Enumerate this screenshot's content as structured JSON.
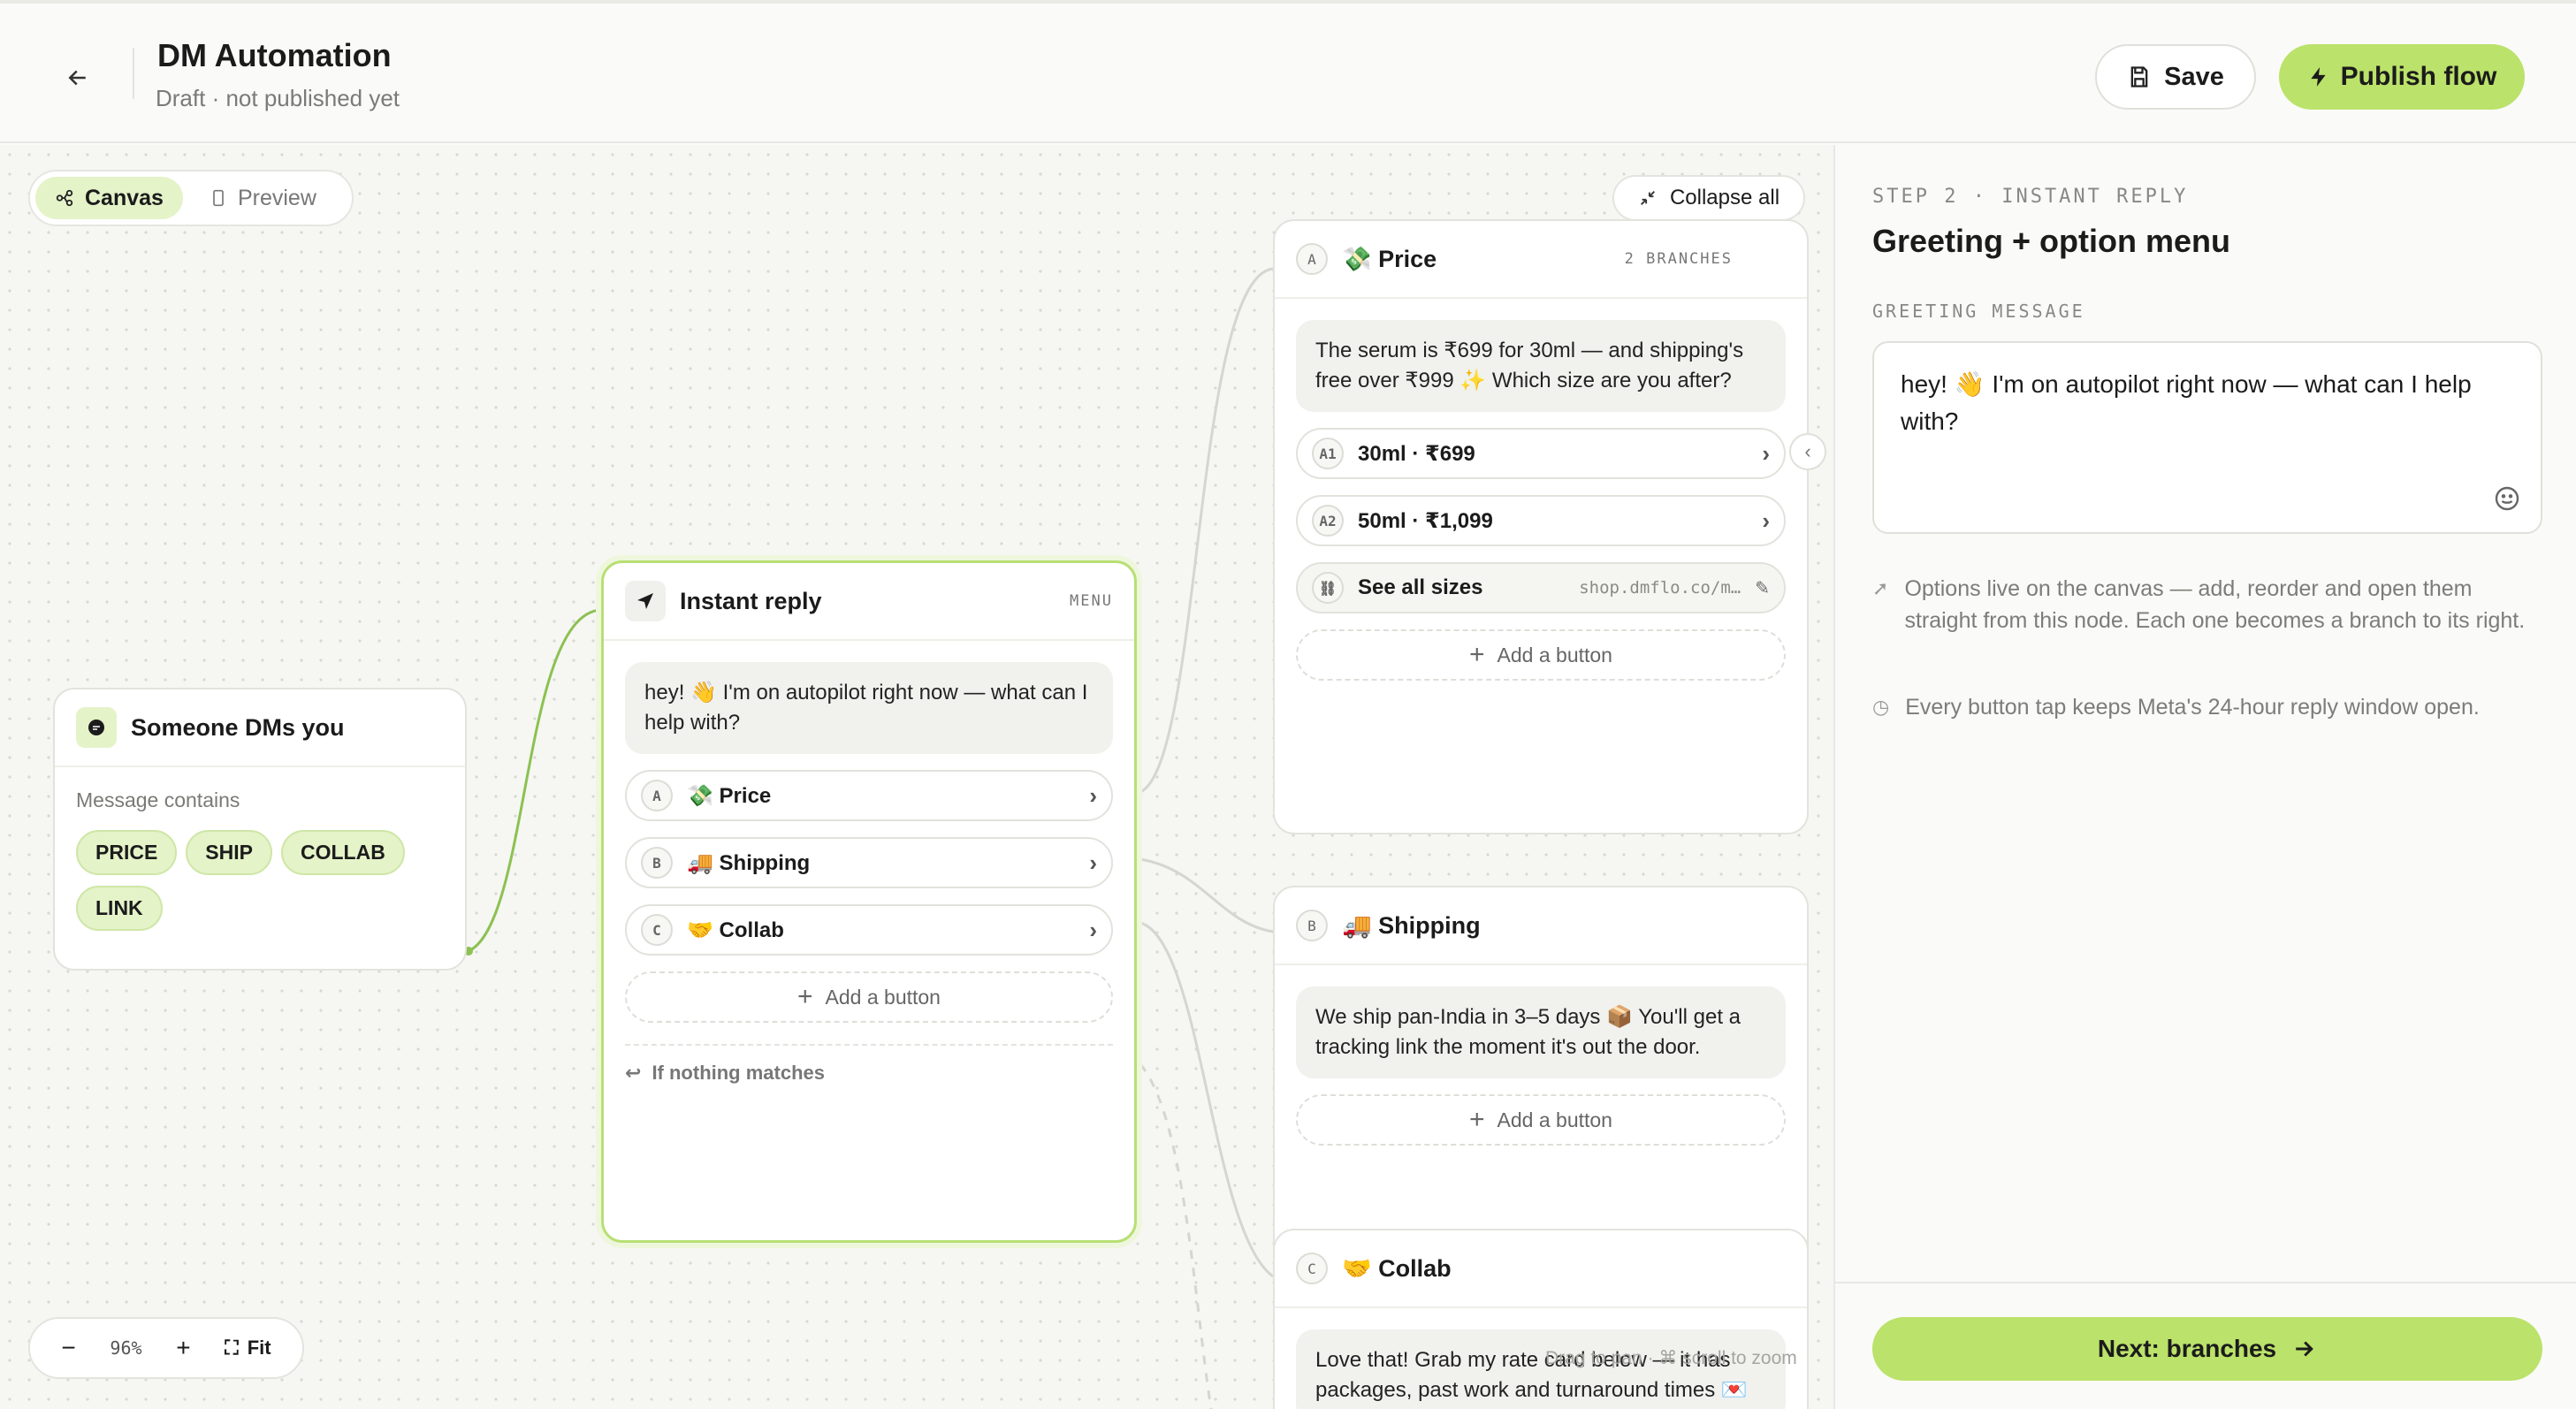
{
  "header": {
    "title": "DM Automation",
    "subtitle": "Draft · not published yet",
    "save_label": "Save",
    "publish_label": "Publish flow"
  },
  "canvas": {
    "toggle": [
      "Canvas",
      "Preview"
    ],
    "collapse_label": "Collapse all",
    "zoom_level": "96%",
    "fit_label": "Fit",
    "hint": "Drag to pan · ⌘ scroll to zoom"
  },
  "trigger_node": {
    "title": "Someone DMs you",
    "condition_label": "Message contains",
    "keywords": [
      "PRICE",
      "SHIP",
      "COLLAB",
      "LINK"
    ]
  },
  "reply_node": {
    "title": "Instant reply",
    "tag": "MENU",
    "message": "hey! 👋 I'm on autopilot right now — what can I help with?",
    "options": [
      {
        "letter": "A",
        "label": "💸 Price"
      },
      {
        "letter": "B",
        "label": "🚚 Shipping"
      },
      {
        "letter": "C",
        "label": "🤝 Collab"
      }
    ],
    "add_label": "Add a button",
    "fallback_label": "If nothing matches"
  },
  "price_node": {
    "letter": "A",
    "title": "💸 Price",
    "tag": "2 BRANCHES",
    "message": "The serum is ₹699 for 30ml — and shipping's free over ₹999 ✨ Which size are you after?",
    "options": [
      {
        "letter": "A1",
        "label": "30ml · ₹699"
      },
      {
        "letter": "A2",
        "label": "50ml · ₹1,099"
      }
    ],
    "link": {
      "label": "See all sizes",
      "url": "shop.dmflo.co/m…"
    },
    "add_label": "Add a button"
  },
  "shipping_node": {
    "letter": "B",
    "title": "🚚 Shipping",
    "message": "We ship pan-India in 3–5 days 📦 You'll get a tracking link the moment it's out the door.",
    "add_label": "Add a button"
  },
  "collab_node": {
    "letter": "C",
    "title": "🤝 Collab",
    "message": "Love that! Grab my rate card below — it has packages, past work and turnaround times 💌"
  },
  "panel": {
    "step": "STEP 2 · INSTANT REPLY",
    "title": "Greeting + option menu",
    "field_label": "GREETING MESSAGE",
    "greeting": "hey! 👋 I'm on autopilot right now — what can I help with?",
    "note1": "Options live on the canvas — add, reorder and open them straight from this node. Each one becomes a branch to its right.",
    "note2": "Every button tap keeps Meta's 24-hour reply window open.",
    "next_label": "Next: branches"
  },
  "colors": {
    "accent": "#bbe26a",
    "accent_soft": "#e4f3c8",
    "connector": "#8cc152"
  }
}
